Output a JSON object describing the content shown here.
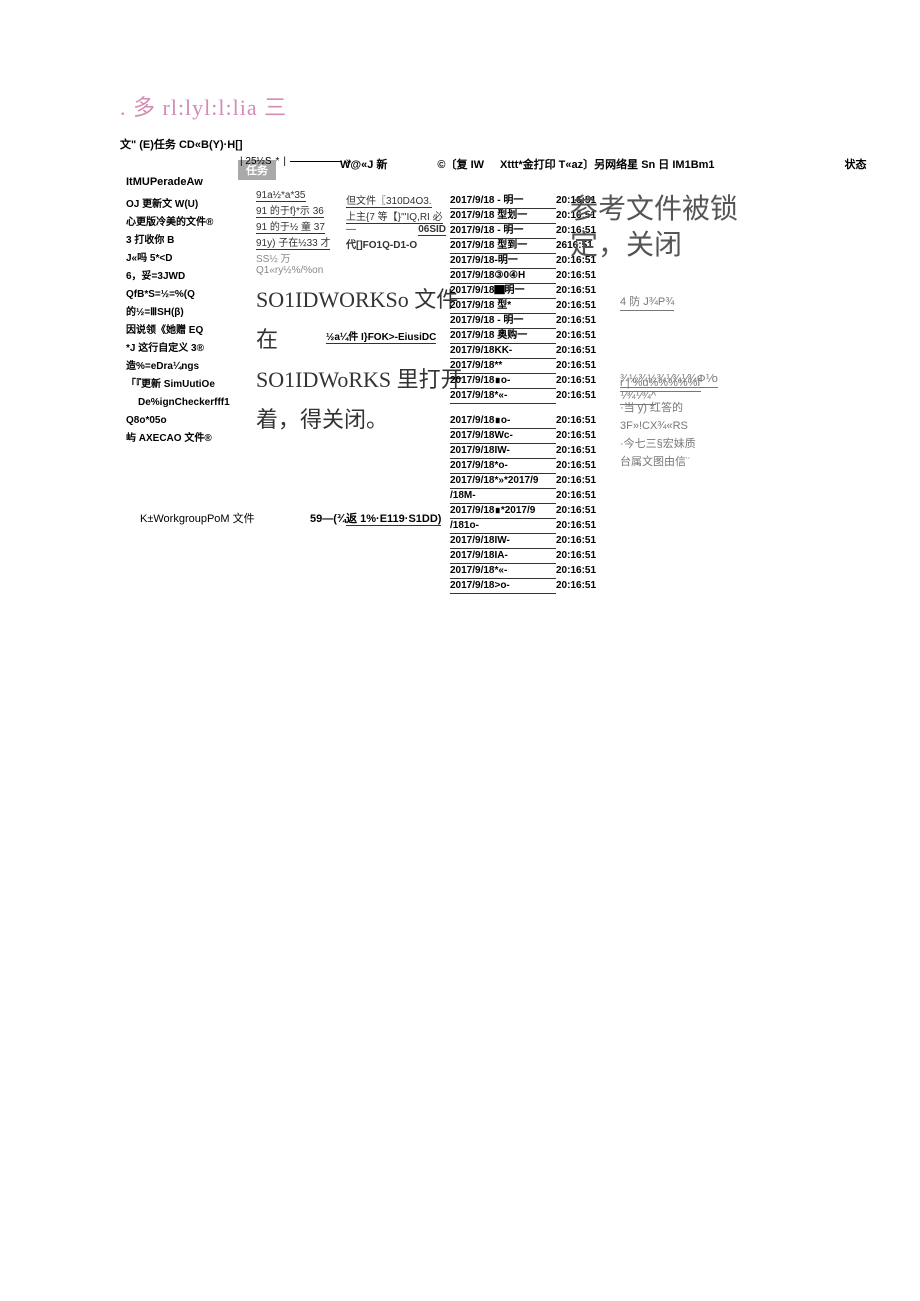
{
  "brand": ". 多 rl:lyl:l:lia 三",
  "menu_bar": "文\" (E)任务 CD«B(Y)·H[]",
  "tab_label": "任务",
  "slider_left": "| 25½S",
  "slider_right": "»",
  "top_row": {
    "c1": "W@«J 新",
    "c2": "©〔复 IW",
    "c3": "Xttt*金打印 T«az〕另网络星 Sn 日 IM1Bm1",
    "c4": "状态"
  },
  "sidebar": {
    "header": "ItMUPeradeAw",
    "items": [
      "OJ 更新文 W(U)",
      "心更版冷美的文件®",
      "3 打收你 B",
      "J«吗 5*<D",
      "6，妥=3JWD",
      "QfB*S=½=%(Q",
      "的½=ⅢSH(β)",
      "因说领《她赠 EQ",
      "*J 这行自定义 3®",
      "造%=eDra¼ngs",
      "「『更新 SimUutiOe",
      "De%ignCheckerfff1",
      "Q8o*05o",
      "屿 AXECAO 文件®"
    ]
  },
  "center": {
    "small_lines": [
      "91a½*a*35",
      "91 的于f}*示 36",
      "91 的于½ 童 37",
      "91y) 子在½33 才",
      "SS½       万",
      "Q1«ry½%/%on"
    ],
    "small_right": [
      "但文件〖310D4O3.",
      "上主{7 等【}'\"IQ,RI 必"
    ],
    "small_right_dash": "—",
    "small_right_id": "06SID",
    "small_right_code": "代[]FO1Q-D1-O",
    "big_line1": "SO1IDWORKSo 文件在",
    "mid_link": "½a¼件 I}FOK>-EiusiDC",
    "big_line2": "SO1IDWoRKS 里打开着，得关闭。"
  },
  "bottom_left": "K±WorkgroupPoM 文件",
  "bottom_center_a": "59—(¾",
  "bottom_center_b": "返 1%·E119·S1DD)",
  "date_table": [
    {
      "d": "2017/9/18 - 明一",
      "t": "20:16:51"
    },
    {
      "d": "2017/9/18 型划一",
      "t": "20:16:51"
    },
    {
      "d": "2017/9/18 - 明一",
      "t": "20:16:51"
    },
    {
      "d": "2017/9/18 型到一",
      "t": "2616:51"
    },
    {
      "d": "2017/9/18-明一",
      "t": "20:16:51"
    },
    {
      "d": "2017/9/18③0④H",
      "t": "20:16:51"
    },
    {
      "d": "2017/9/18▇明一",
      "t": "20:16:51"
    },
    {
      "d": "2017/9/18 型*",
      "t": "20:16:51"
    },
    {
      "d": "2017/9/18 - 明一",
      "t": "20:16:51"
    },
    {
      "d": "2017/9/18 奥购一",
      "t": "20:16:51"
    },
    {
      "d": "2017/9/18KK-",
      "t": "20:16:51"
    },
    {
      "d": "2017/9/18**",
      "t": "20:16:51"
    },
    {
      "d": "2017/9/18∎o-",
      "t": "20:16:51"
    },
    {
      "d": "2017/9/18*«-",
      "t": "20:16:51"
    }
  ],
  "date_table2": [
    {
      "d": "2017/9/18∎o-",
      "t": "20:16:51"
    },
    {
      "d": "2017/9/18Wc-",
      "t": "20:16:51"
    },
    {
      "d": "2017/9/18IW-",
      "t": "20:16:51"
    },
    {
      "d": "2017/9/18*o-",
      "t": "20:16:51"
    },
    {
      "d": "2017/9/18*»*2017/9",
      "t": "20:16:51"
    },
    {
      "d": "/18M-",
      "t": "20:16:51"
    },
    {
      "d": "2017/9/18∎*2017/9",
      "t": "20:16:51"
    },
    {
      "d": "/181o-",
      "t": "20:16:51"
    },
    {
      "d": "2017/9/18IW-",
      "t": "20:16:51"
    },
    {
      "d": "2017/9/18IA-",
      "t": "20:16:51"
    },
    {
      "d": "2017/9/18*«-",
      "t": "20:16:51"
    },
    {
      "d": "2017/9/18>o-",
      "t": "20:16:51"
    }
  ],
  "right_big": "参考文件被锁\n定，关闭",
  "right_links": {
    "a": "4 防 J¾P¾",
    "b1": "¾½¾½¾⅟¾⅟¾Φ⅟o",
    "b2": "⅟¾⅟¾^",
    "c": "r | %u%%%%%f",
    "tight": [
      "·当 y)  红答的",
      "3F»!CX¾«RS",
      "·今七三§宏妹质",
      "台属文图由信¨"
    ]
  }
}
